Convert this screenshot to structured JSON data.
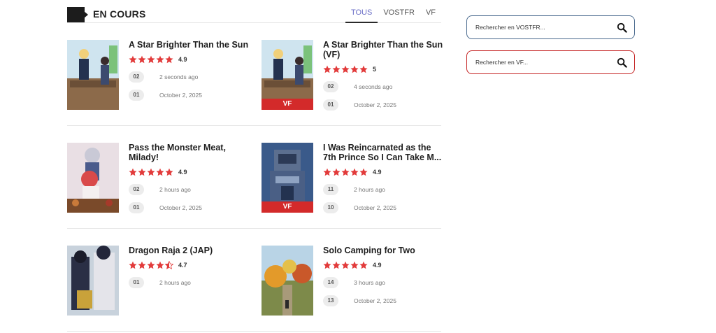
{
  "section": {
    "title": "EN COURS",
    "tabs": [
      "TOUS",
      "VOSTFR",
      "VF"
    ],
    "active_tab": "TOUS"
  },
  "colors": {
    "accent": "#6b6fc7",
    "star": "#e23b3b",
    "vf_tag": "#d32a2a",
    "search_blue": "#4a6a8e",
    "search_red": "#c42222"
  },
  "cards": [
    {
      "title": "A Star Brighter Than the Sun",
      "rating": "4.9",
      "stars": 5,
      "vf": false,
      "episodes": [
        {
          "num": "02",
          "time": "2 seconds ago"
        },
        {
          "num": "01",
          "time": "October 2, 2025"
        }
      ]
    },
    {
      "title": "A Star Brighter Than the Sun (VF)",
      "rating": "5",
      "stars": 5,
      "vf": true,
      "vf_label": "VF",
      "episodes": [
        {
          "num": "02",
          "time": "4 seconds ago"
        },
        {
          "num": "01",
          "time": "October 2, 2025"
        }
      ]
    },
    {
      "title": "Pass the Monster Meat, Milady!",
      "rating": "4.9",
      "stars": 5,
      "vf": false,
      "episodes": [
        {
          "num": "02",
          "time": "2 hours ago"
        },
        {
          "num": "01",
          "time": "October 2, 2025"
        }
      ]
    },
    {
      "title": "I Was Reincarnated as the 7th Prince So I Can Take M...",
      "rating": "4.9",
      "stars": 5,
      "vf": true,
      "vf_label": "VF",
      "episodes": [
        {
          "num": "11",
          "time": "2 hours ago"
        },
        {
          "num": "10",
          "time": "October 2, 2025"
        }
      ]
    },
    {
      "title": "Dragon Raja 2 (JAP)",
      "rating": "4.7",
      "stars": 4.5,
      "vf": false,
      "episodes": [
        {
          "num": "01",
          "time": "2 hours ago"
        }
      ]
    },
    {
      "title": "Solo Camping for Two",
      "rating": "4.9",
      "stars": 5,
      "vf": false,
      "episodes": [
        {
          "num": "14",
          "time": "3 hours ago"
        },
        {
          "num": "13",
          "time": "October 2, 2025"
        }
      ]
    }
  ],
  "sidebar": {
    "search_vostfr_placeholder": "Rechercher en VOSTFR...",
    "search_vf_placeholder": "Rechercher en VF..."
  }
}
